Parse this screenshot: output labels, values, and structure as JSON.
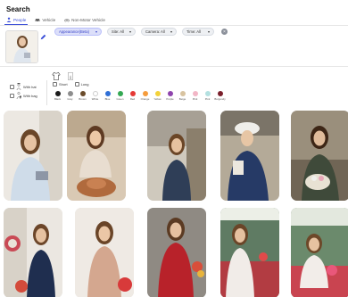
{
  "page": {
    "title": "Search"
  },
  "tabs": [
    {
      "label": "People",
      "active": true,
      "icon": "person-icon"
    },
    {
      "label": "Vehicle",
      "active": false,
      "icon": "car-icon"
    },
    {
      "label": "Non-Motor Vehicle",
      "active": false,
      "icon": "bicycle-icon"
    }
  ],
  "filters": {
    "appearance": "Appearance(Beta)",
    "site": "Site: All",
    "camera": "Camera: All",
    "time": "Time: All"
  },
  "attributes": {
    "with_hat": "With hat",
    "with_bag": "With bag",
    "length_options": [
      "Short",
      "Long"
    ]
  },
  "colors": [
    {
      "name": "Black",
      "hex": "#1b1b1b"
    },
    {
      "name": "Gray",
      "hex": "#8d8d8d"
    },
    {
      "name": "Brown",
      "hex": "#6a4b2b"
    },
    {
      "name": "White",
      "hex": "#ffffff"
    },
    {
      "name": "Blue",
      "hex": "#2f6fd6"
    },
    {
      "name": "Green",
      "hex": "#34a853"
    },
    {
      "name": "Red",
      "hex": "#e53935"
    },
    {
      "name": "Orange",
      "hex": "#f59c3c"
    },
    {
      "name": "Yellow",
      "hex": "#f3d23a"
    },
    {
      "name": "Purple",
      "hex": "#8e44ad"
    },
    {
      "name": "Beige",
      "hex": "#d8c3a0"
    },
    {
      "name": "Pink",
      "hex": "#f2b6c6"
    },
    {
      "name": "Pink",
      "hex": "#b3e0e0"
    },
    {
      "name": "Burgundy",
      "hex": "#7a1f2b"
    }
  ],
  "results_count": 10
}
